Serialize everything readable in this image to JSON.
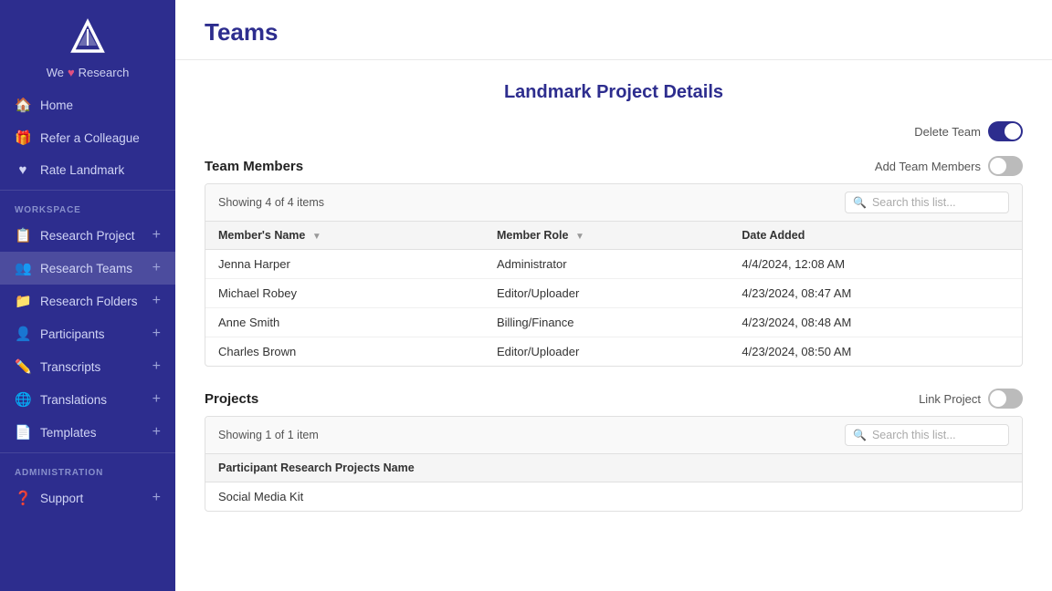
{
  "app": {
    "logo_alt": "We Research Logo",
    "tagline_prefix": "We",
    "heart": "♥",
    "tagline_suffix": "Research"
  },
  "sidebar": {
    "top_nav": [
      {
        "id": "home",
        "label": "Home",
        "icon": "🏠"
      },
      {
        "id": "refer",
        "label": "Refer a Colleague",
        "icon": "🎁"
      },
      {
        "id": "rate",
        "label": "Rate Landmark",
        "icon": "♥"
      }
    ],
    "workspace_label": "WORKSPACE",
    "workspace_items": [
      {
        "id": "research-project",
        "label": "Research Project",
        "icon": "📋",
        "has_plus": true
      },
      {
        "id": "research-teams",
        "label": "Research Teams",
        "icon": "👥",
        "has_plus": true
      },
      {
        "id": "research-folders",
        "label": "Research Folders",
        "icon": "📁",
        "has_plus": true
      },
      {
        "id": "participants",
        "label": "Participants",
        "icon": "👤",
        "has_plus": true
      },
      {
        "id": "transcripts",
        "label": "Transcripts",
        "icon": "✏️",
        "has_plus": true
      },
      {
        "id": "translations",
        "label": "Translations",
        "icon": "🌐",
        "has_plus": true
      },
      {
        "id": "templates",
        "label": "Templates",
        "icon": "📄",
        "has_plus": true
      }
    ],
    "admin_label": "ADMINISTRATION",
    "admin_items": [
      {
        "id": "support",
        "label": "Support",
        "icon": "❓",
        "has_plus": true
      }
    ]
  },
  "page": {
    "title": "Teams",
    "project_heading": "Landmark Project Details",
    "delete_team_label": "Delete Team",
    "team_members_label": "Team Members",
    "add_team_members_label": "Add Team Members",
    "showing_members": "Showing 4 of 4 items",
    "search_placeholder": "Search this list...",
    "columns": [
      {
        "key": "name",
        "label": "Member's Name"
      },
      {
        "key": "role",
        "label": "Member Role"
      },
      {
        "key": "date",
        "label": "Date Added"
      }
    ],
    "members": [
      {
        "name": "Jenna Harper",
        "role": "Administrator",
        "date": "4/4/2024, 12:08 AM"
      },
      {
        "name": "Michael Robey",
        "role": "Editor/Uploader",
        "date": "4/23/2024, 08:47 AM"
      },
      {
        "name": "Anne Smith",
        "role": "Billing/Finance",
        "date": "4/23/2024, 08:48 AM"
      },
      {
        "name": "Charles Brown",
        "role": "Editor/Uploader",
        "date": "4/23/2024, 08:50 AM"
      }
    ],
    "projects_label": "Projects",
    "link_project_label": "Link Project",
    "showing_projects": "Showing 1 of 1 item",
    "project_column": "Participant Research Projects Name",
    "projects": [
      {
        "name": "Social Media Kit"
      }
    ]
  }
}
